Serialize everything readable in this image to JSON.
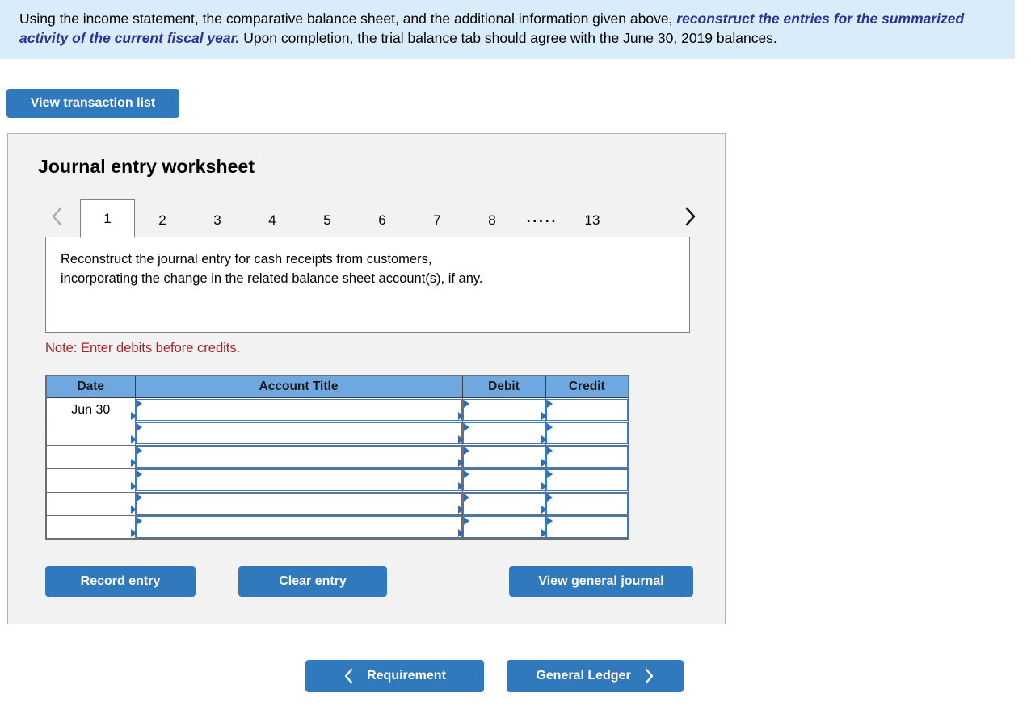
{
  "banner": {
    "text_before": "Using the income statement, the comparative balance sheet, and the additional information given above, ",
    "emphasis": "reconstruct the entries for the summarized activity of the current fiscal year.",
    "text_after": "  Upon completion, the trial balance tab should agree with the June 30, 2019 balances."
  },
  "toolbar": {
    "view_transaction_list_label": "View transaction list"
  },
  "worksheet": {
    "title": "Journal entry worksheet",
    "prev_icon": "chevron-left-icon",
    "next_icon": "chevron-right-icon",
    "tabs": [
      "1",
      "2",
      "3",
      "4",
      "5",
      "6",
      "7",
      "8"
    ],
    "tab_ellipsis": ".....",
    "tab_last": "13",
    "active_tab": "1",
    "instruction_line1": "Reconstruct the journal entry for cash receipts from customers,",
    "instruction_line2": "incorporating the change in the related balance sheet account(s), if any.",
    "note": "Note: Enter debits before credits.",
    "actions": {
      "record_entry_label": "Record entry",
      "clear_entry_label": "Clear entry",
      "view_general_journal_label": "View general journal"
    }
  },
  "journal_table": {
    "headers": [
      "Date",
      "Account Title",
      "Debit",
      "Credit"
    ],
    "rows": [
      {
        "date": "Jun 30",
        "account": "",
        "debit": "",
        "credit": ""
      },
      {
        "date": "",
        "account": "",
        "debit": "",
        "credit": ""
      },
      {
        "date": "",
        "account": "",
        "debit": "",
        "credit": ""
      },
      {
        "date": "",
        "account": "",
        "debit": "",
        "credit": ""
      },
      {
        "date": "",
        "account": "",
        "debit": "",
        "credit": ""
      },
      {
        "date": "",
        "account": "",
        "debit": "",
        "credit": ""
      }
    ]
  },
  "bottom_nav": {
    "requirement_label": "Requirement",
    "requirement_icon": "chevron-left-icon",
    "general_ledger_label": "General Ledger",
    "general_ledger_icon": "chevron-right-icon"
  },
  "colors": {
    "banner_bg": "#d9ecf9",
    "emphasis_text": "#2f2f96",
    "button_blue": "#3179bd",
    "table_header_blue": "#6fa8e0",
    "note_red": "#b01d22",
    "panel_bg": "#f2f2f2",
    "input_border_blue": "#3b7cc0"
  }
}
